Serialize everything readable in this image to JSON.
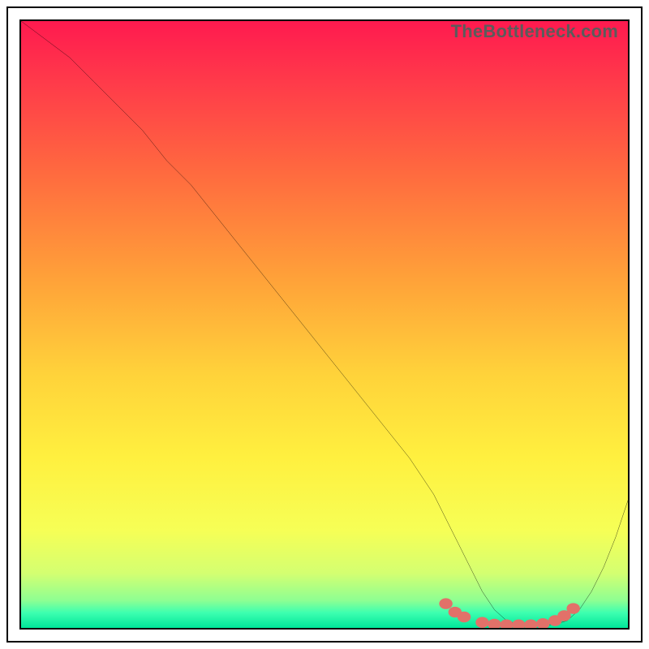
{
  "watermark": "TheBottleneck.com",
  "chart_data": {
    "type": "line",
    "title": "",
    "xlabel": "",
    "ylabel": "",
    "xlim": [
      0,
      100
    ],
    "ylim": [
      0,
      100
    ],
    "series": [
      {
        "name": "bottleneck-curve",
        "x": [
          0,
          4,
          8,
          12,
          16,
          20,
          24,
          28,
          32,
          36,
          40,
          44,
          48,
          52,
          56,
          60,
          64,
          68,
          70,
          72,
          74,
          76,
          78,
          80,
          82,
          84,
          86,
          88,
          90,
          92,
          94,
          96,
          98,
          100
        ],
        "y": [
          100,
          97,
          94,
          90,
          86,
          82,
          77,
          73,
          68,
          63,
          58,
          53,
          48,
          43,
          38,
          33,
          28,
          22,
          18,
          14,
          10,
          6,
          3,
          1.2,
          0.6,
          0.4,
          0.4,
          0.6,
          1.2,
          3,
          6,
          10,
          15,
          21
        ],
        "color": "#000000"
      }
    ],
    "markers": {
      "name": "selected-range-dots",
      "color": "#e27169",
      "points": [
        {
          "x": 70,
          "y": 4.0
        },
        {
          "x": 71.5,
          "y": 2.6
        },
        {
          "x": 73,
          "y": 1.8
        },
        {
          "x": 76,
          "y": 0.9
        },
        {
          "x": 78,
          "y": 0.6
        },
        {
          "x": 80,
          "y": 0.5
        },
        {
          "x": 82,
          "y": 0.5
        },
        {
          "x": 84,
          "y": 0.5
        },
        {
          "x": 86,
          "y": 0.7
        },
        {
          "x": 88,
          "y": 1.2
        },
        {
          "x": 89.5,
          "y": 2.0
        },
        {
          "x": 91,
          "y": 3.2
        }
      ]
    },
    "gradient_stops": [
      {
        "offset": 0.0,
        "color": "#ff1a4f"
      },
      {
        "offset": 0.1,
        "color": "#ff3a4a"
      },
      {
        "offset": 0.25,
        "color": "#ff6a3f"
      },
      {
        "offset": 0.42,
        "color": "#ffa039"
      },
      {
        "offset": 0.58,
        "color": "#ffd23a"
      },
      {
        "offset": 0.72,
        "color": "#fff03f"
      },
      {
        "offset": 0.84,
        "color": "#f6ff56"
      },
      {
        "offset": 0.91,
        "color": "#d4ff71"
      },
      {
        "offset": 0.955,
        "color": "#8dff93"
      },
      {
        "offset": 0.975,
        "color": "#3dffb0"
      },
      {
        "offset": 1.0,
        "color": "#00e69a"
      }
    ]
  }
}
